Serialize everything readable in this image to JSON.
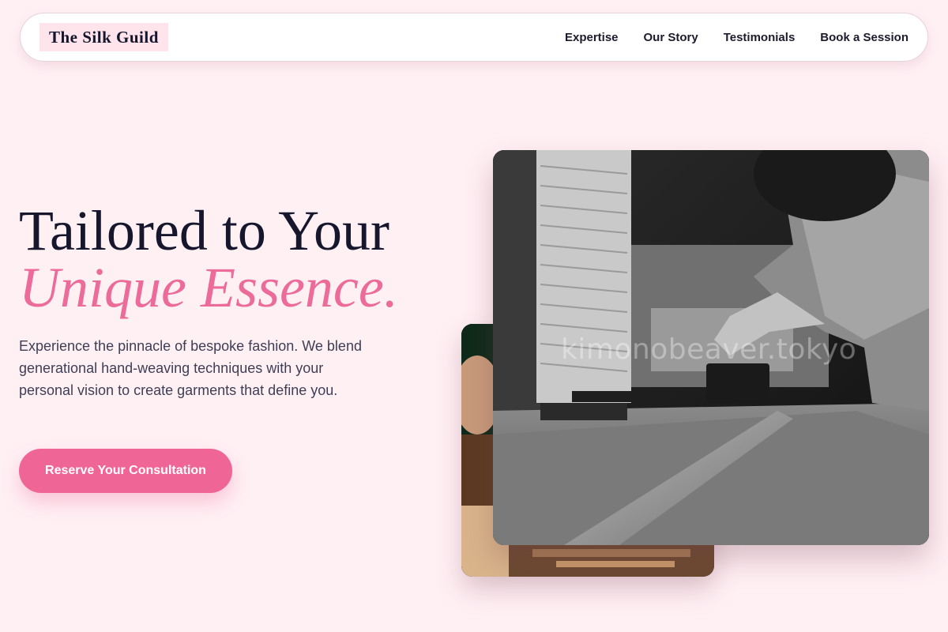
{
  "nav": {
    "brand": "The Silk Guild",
    "links": [
      {
        "label": "Expertise"
      },
      {
        "label": "Our Story"
      },
      {
        "label": "Testimonials"
      },
      {
        "label": "Book a Session"
      }
    ]
  },
  "hero": {
    "title_line1": "Tailored to Your",
    "title_line2": "Unique Essence.",
    "description": "Experience the pinnacle of bespoke fashion. We blend generational hand-weaving techniques with your personal vision to create garments that define you.",
    "cta_label": "Reserve Your Consultation"
  },
  "images": {
    "front_watermark": "kimonobeaver.tokyo"
  },
  "colors": {
    "background": "#fff0f4",
    "accent": "#ef6596",
    "title_accent": "#ec6b98",
    "text_dark": "#16162c",
    "brand_bg": "#ffe4ec"
  }
}
